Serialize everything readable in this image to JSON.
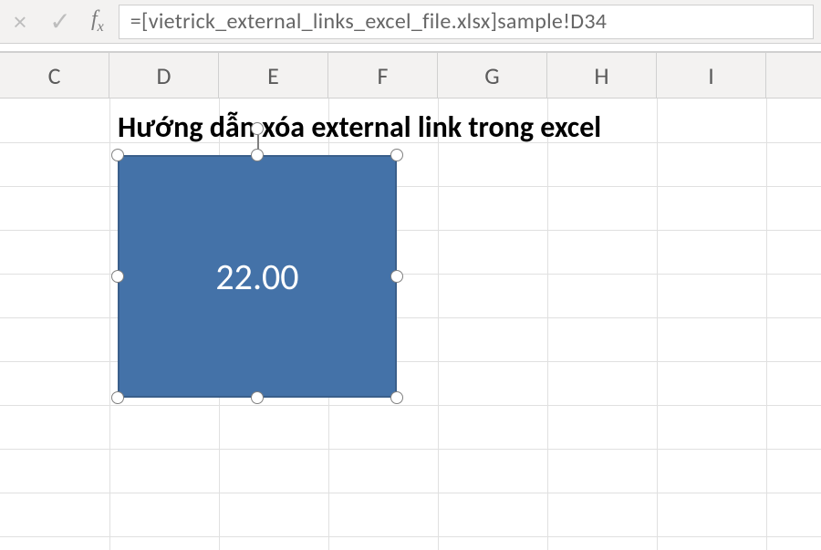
{
  "formula_bar": {
    "cancel_icon": "×",
    "enter_icon": "✓",
    "fx_label": "f",
    "fx_sub": "x",
    "formula": "=[vietrick_external_links_excel_file.xlsx]sample!D34"
  },
  "columns": [
    "C",
    "D",
    "E",
    "F",
    "G",
    "H",
    "I"
  ],
  "sheet": {
    "heading": "Hướng dẫn xóa external link trong excel",
    "shape_value": "22.00"
  }
}
